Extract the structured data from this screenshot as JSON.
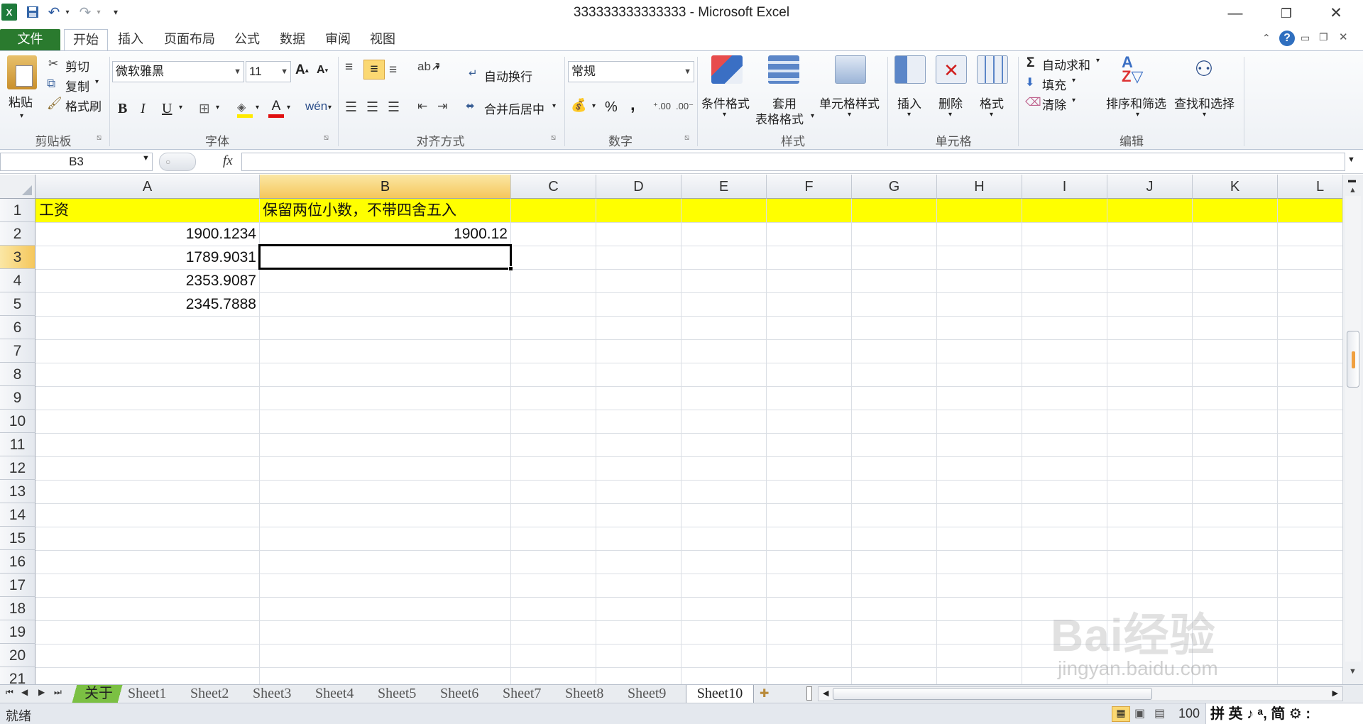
{
  "window": {
    "title": "333333333333333  -  Microsoft Excel",
    "quick_access": {
      "customize": "▾"
    }
  },
  "ribbon_tabs": [
    "文件",
    "开始",
    "插入",
    "页面布局",
    "公式",
    "数据",
    "审阅",
    "视图"
  ],
  "clipboard": {
    "paste": "粘贴",
    "cut": "剪切",
    "copy": "复制",
    "format_painter": "格式刷",
    "group_label": "剪贴板"
  },
  "font": {
    "name": "微软雅黑",
    "size": "11",
    "bold": "B",
    "italic": "I",
    "underline": "U",
    "group_label": "字体"
  },
  "alignment": {
    "wrap_text": "自动换行",
    "merge_center": "合并后居中",
    "group_label": "对齐方式"
  },
  "number": {
    "format": "常规",
    "percent": "%",
    "comma": ",",
    "group_label": "数字"
  },
  "styles": {
    "conditional": "条件格式",
    "format_table_1": "套用",
    "format_table_2": "表格格式",
    "cell_styles": "单元格样式",
    "group_label": "样式"
  },
  "cells_group": {
    "insert": "插入",
    "delete": "删除",
    "format": "格式",
    "group_label": "单元格"
  },
  "editing": {
    "autosum": "自动求和",
    "fill": "填充",
    "clear": "清除",
    "sort_filter": "排序和筛选",
    "find_select": "查找和选择",
    "group_label": "编辑"
  },
  "formula_bar": {
    "name_box": "B3",
    "fx": "fx",
    "content": ""
  },
  "grid": {
    "columns": [
      "A",
      "B",
      "C",
      "D",
      "E",
      "F",
      "G",
      "H",
      "I",
      "J",
      "K",
      "L"
    ],
    "rows": [
      "1",
      "2",
      "3",
      "4",
      "5",
      "6",
      "7",
      "8",
      "9",
      "10",
      "11",
      "12",
      "13",
      "14",
      "15",
      "16",
      "17",
      "18",
      "19",
      "20",
      "21"
    ],
    "cells": {
      "A1": "工资",
      "B1": "保留两位小数，不带四舍五入",
      "A2": "1900.1234",
      "B2": "1900.12",
      "A3": "1789.9031",
      "A4": "2353.9087",
      "A5": "2345.7888"
    },
    "selected_cell": "B3",
    "highlight_color": "#ffff00"
  },
  "sheet_tabs": [
    "关于",
    "Sheet1",
    "Sheet2",
    "Sheet3",
    "Sheet4",
    "Sheet5",
    "Sheet6",
    "Sheet7",
    "Sheet8",
    "Sheet9",
    "Sheet10"
  ],
  "active_sheet": "Sheet10",
  "status_bar": {
    "mode": "就绪",
    "zoom": "100",
    "ime": "拼 英 ♪ ᵃ, 简 ⚙ :"
  },
  "watermark": {
    "brand": "Bai经验",
    "url": "jingyan.baidu.com"
  }
}
